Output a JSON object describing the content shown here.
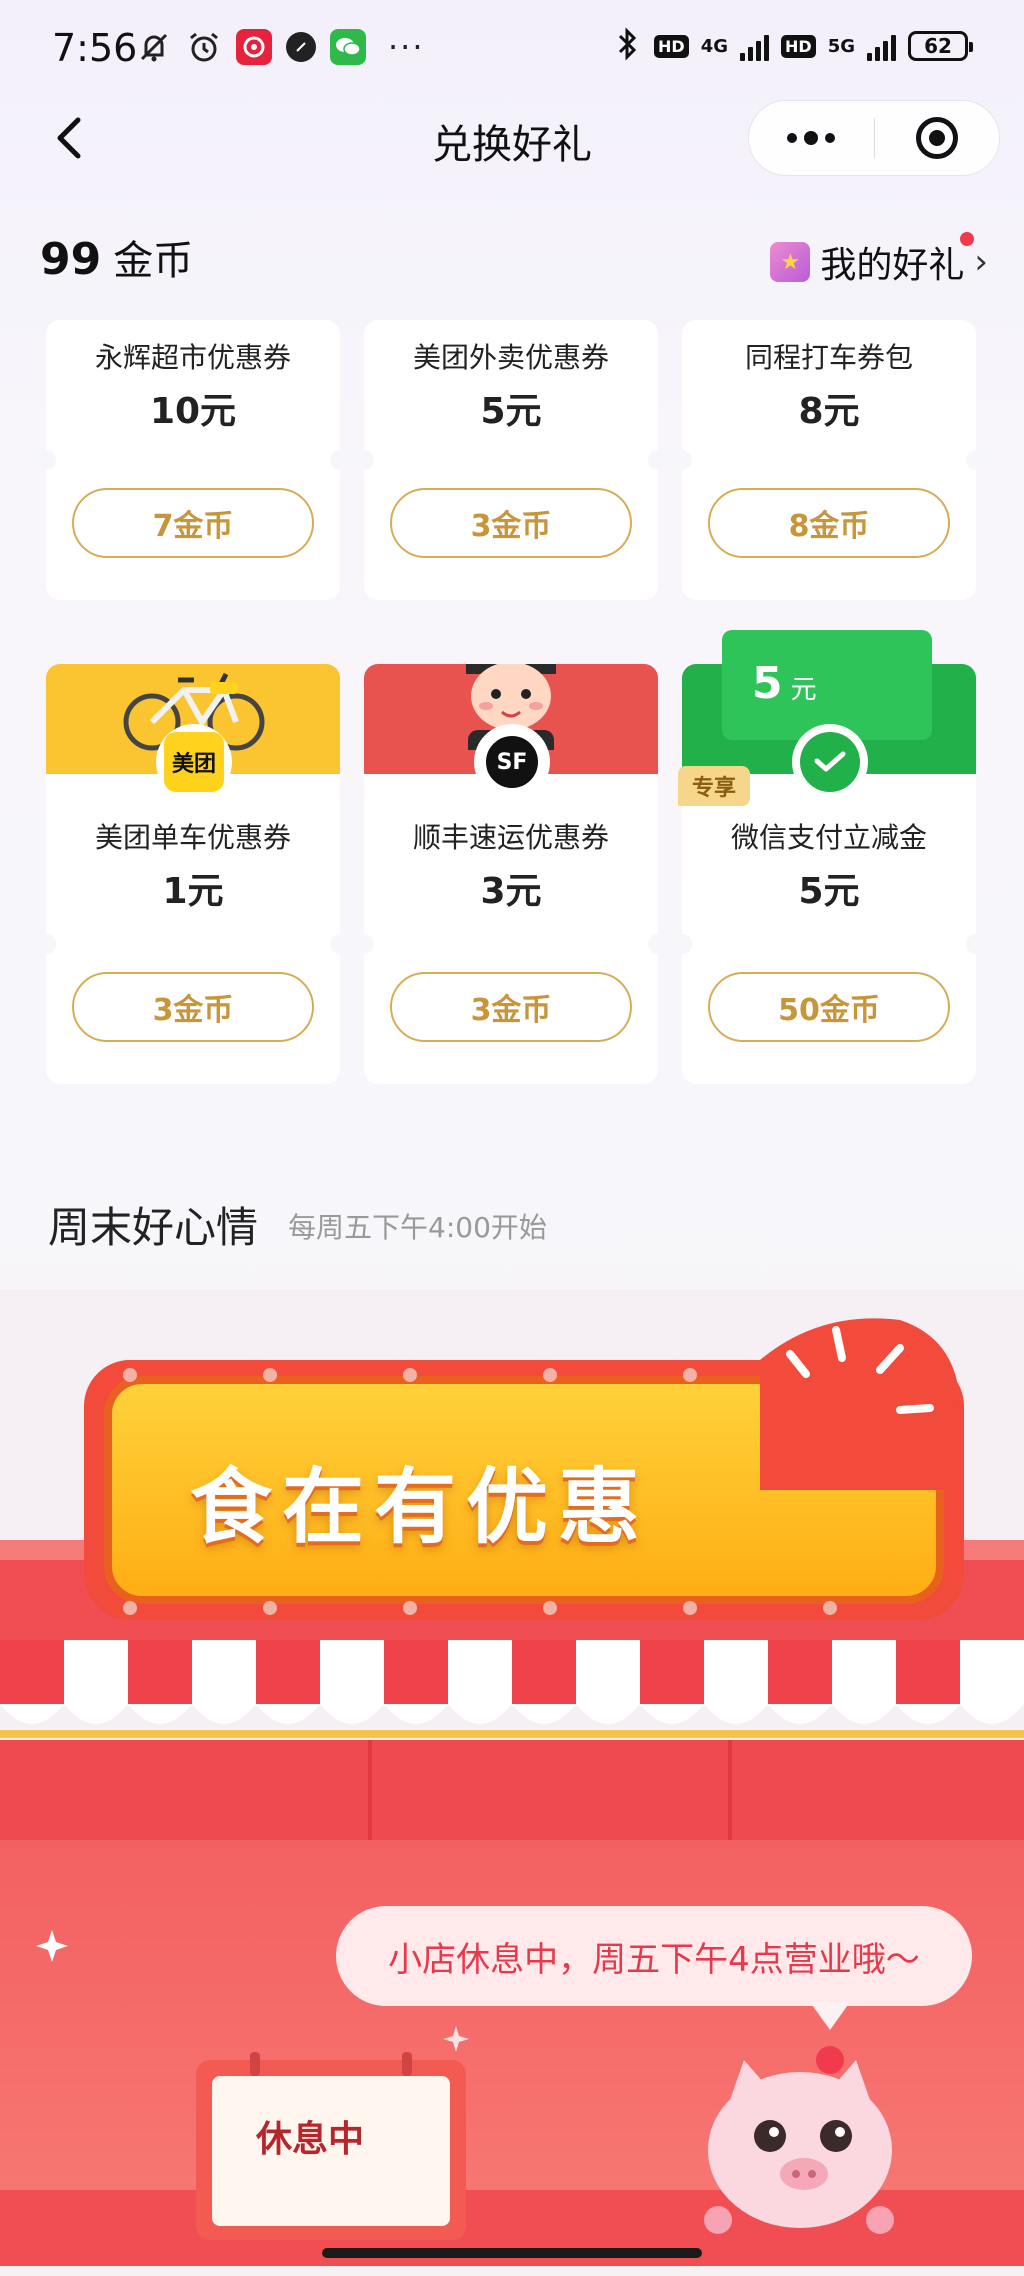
{
  "status_bar": {
    "time": "7:56",
    "more": "···",
    "hd1": "HD",
    "net1": "4G",
    "hd2": "HD",
    "net2": "5G",
    "battery": "62"
  },
  "nav": {
    "title": "兑换好礼",
    "back_icon": "chevron-left-icon",
    "more_icon": "more-dots-icon",
    "close_icon": "target-icon"
  },
  "coins": {
    "amount": "99",
    "unit": "金币"
  },
  "my_gifts": {
    "label": "我的好礼"
  },
  "cards": [
    {
      "name": "永辉超市优惠券",
      "value": "10元",
      "price": "7金币"
    },
    {
      "name": "美团外卖优惠券",
      "value": "5元",
      "price": "3金币"
    },
    {
      "name": "同程打车券包",
      "value": "8元",
      "price": "8金币"
    },
    {
      "name": "美团单车优惠券",
      "value": "1元",
      "price": "3金币",
      "logo_text": "美团",
      "top_color": "#fbc531"
    },
    {
      "name": "顺丰速运优惠券",
      "value": "3元",
      "price": "3金币",
      "logo_text": "SF",
      "top_color": "#e8524f"
    },
    {
      "name": "微信支付立减金",
      "value": "5元",
      "price": "50金币",
      "badge": "专享",
      "top_num": "5",
      "top_unit": "元",
      "top_color": "#22b04b"
    }
  ],
  "section": {
    "title": "周末好心情",
    "subtitle": "每周五下午4:00开始"
  },
  "banner": {
    "headline": "食在有优惠",
    "bubble": "小店休息中，周五下午4点营业哦～",
    "sign": "休息中"
  }
}
